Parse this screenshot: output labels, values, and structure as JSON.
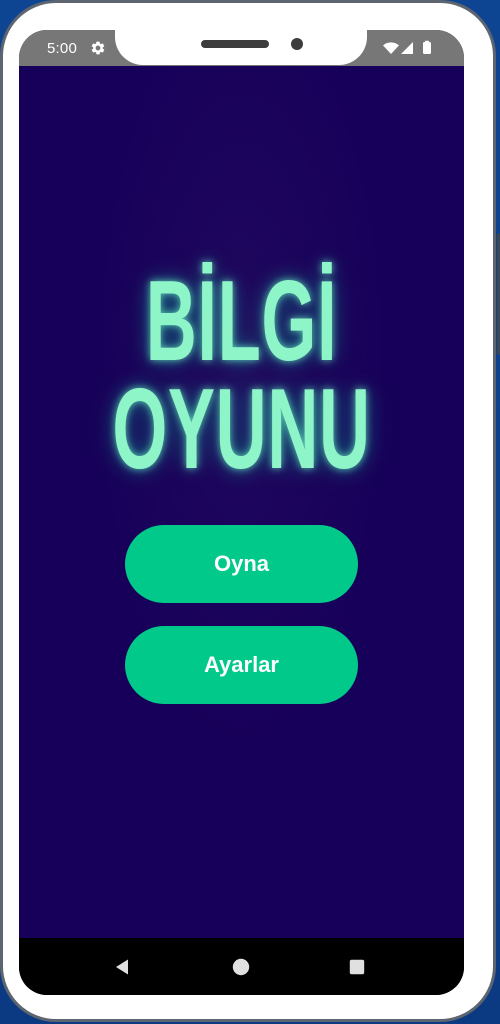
{
  "status_bar": {
    "time": "5:00",
    "left_icon": "gear-icon",
    "right_icons": [
      "wifi-icon",
      "signal-icon",
      "battery-icon"
    ]
  },
  "title": {
    "line1": "BİLGİ",
    "line2": "OYUNU"
  },
  "buttons": {
    "play": "Oyna",
    "settings": "Ayarlar"
  },
  "navigation": {
    "back_icon": "back-triangle-icon",
    "home_icon": "home-circle-icon",
    "recent_icon": "recent-square-icon"
  },
  "colors": {
    "background": "#170059",
    "title": "#8ef5c8",
    "button": "#00c98a",
    "nav_bar": "#000000"
  }
}
